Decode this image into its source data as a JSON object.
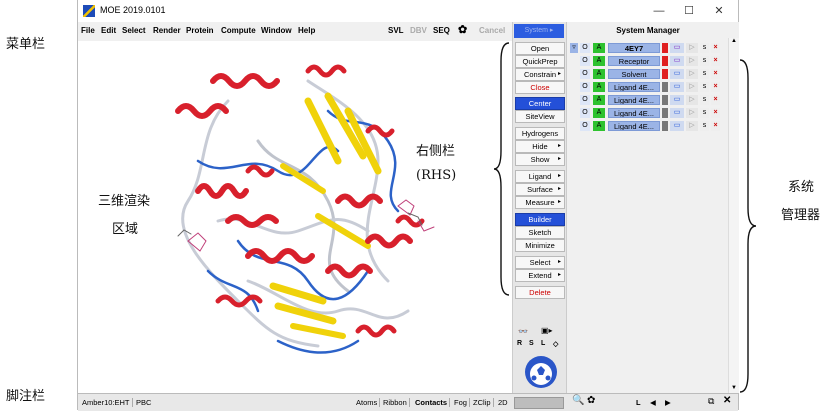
{
  "annotations": {
    "menubar": "菜单栏",
    "viewport_line1": "三维渲染",
    "viewport_line2": "区域",
    "rhs_line1": "右侧栏",
    "rhs_line2": "(RHS)",
    "sysmgr_line1": "系统",
    "sysmgr_line2": "管理器",
    "footer": "脚注栏"
  },
  "window": {
    "title": "MOE 2019.0101",
    "controls": {
      "minimize": "—",
      "maximize": "☐",
      "close": "✕"
    }
  },
  "menu": {
    "items": [
      "File",
      "Edit",
      "Select",
      "Render",
      "Protein",
      "Compute",
      "Window",
      "Help"
    ],
    "toolbar": {
      "svl": "SVL",
      "dbv": "DBV",
      "seq": "SEQ",
      "cancel": "Cancel",
      "system": "System ▸"
    }
  },
  "rhs": {
    "buttons": [
      {
        "label": "Open",
        "style": "normal",
        "arrow": false
      },
      {
        "label": "QuickPrep",
        "style": "normal",
        "arrow": false
      },
      {
        "label": "Constrain",
        "style": "normal",
        "arrow": true
      },
      {
        "label": "Close",
        "style": "red",
        "arrow": false
      },
      {
        "label": "Center",
        "style": "sel",
        "arrow": false
      },
      {
        "label": "SiteView",
        "style": "normal",
        "arrow": false
      },
      {
        "label": "Hydrogens",
        "style": "normal",
        "arrow": false
      },
      {
        "label": "Hide",
        "style": "normal",
        "arrow": true
      },
      {
        "label": "Show",
        "style": "normal",
        "arrow": true
      },
      {
        "label": "Ligand",
        "style": "normal",
        "arrow": true
      },
      {
        "label": "Surface",
        "style": "normal",
        "arrow": true
      },
      {
        "label": "Measure",
        "style": "normal",
        "arrow": true
      },
      {
        "label": "Builder",
        "style": "sel",
        "arrow": false
      },
      {
        "label": "Sketch",
        "style": "normal",
        "arrow": false
      },
      {
        "label": "Minimize",
        "style": "normal",
        "arrow": false
      },
      {
        "label": "Select",
        "style": "normal",
        "arrow": true
      },
      {
        "label": "Extend",
        "style": "normal",
        "arrow": true
      },
      {
        "label": "Delete",
        "style": "red",
        "arrow": false
      }
    ],
    "view_keys": [
      "R",
      "S",
      "L",
      "◇"
    ]
  },
  "system_manager": {
    "title": "System Manager",
    "rows": [
      {
        "name": "4EY7",
        "bold": true,
        "color": "#e02020"
      },
      {
        "name": "Receptor",
        "bold": false,
        "color": "#e02020"
      },
      {
        "name": "Solvent",
        "bold": false,
        "color": "#e02020"
      },
      {
        "name": "Ligand 4E...",
        "bold": false,
        "color": "#777777"
      },
      {
        "name": "Ligand 4E...",
        "bold": false,
        "color": "#777777"
      },
      {
        "name": "Ligand 4E...",
        "bold": false,
        "color": "#777777"
      },
      {
        "name": "Ligand 4E...",
        "bold": false,
        "color": "#777777"
      }
    ],
    "row_flags": {
      "visible": "O",
      "active": "A",
      "s": "s",
      "delete": "×"
    },
    "footer_key": "L"
  },
  "status": {
    "forcefield": "Amber10:EHT",
    "pbc": "PBC",
    "atoms": "Atoms",
    "ribbon": "Ribbon",
    "contacts": "Contacts",
    "fog": "Fog",
    "zclip": "ZClip",
    "twod": "2D"
  },
  "colors": {
    "helix": "#d8202c",
    "sheet": "#f0d20a",
    "coil_blue": "#2c62c8",
    "coil_grey": "#c8ccd6",
    "accent": "#2450d8"
  }
}
